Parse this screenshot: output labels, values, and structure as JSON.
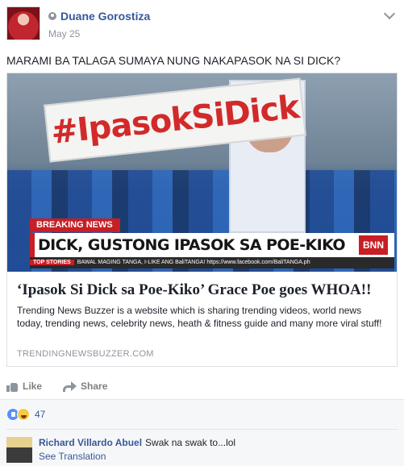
{
  "post": {
    "author": "Duane Gorostiza",
    "date": "May 25",
    "text": "MARAMI BA TALAGA SUMAYA NUNG NAKAPASOK NA SI DICK?"
  },
  "link_card": {
    "image": {
      "sign_text": "#IpasokSiDick",
      "breaking_label": "BREAKING NEWS",
      "headline": "DICK, GUSTONG IPASOK SA POE-KIKO",
      "logo": "BNN",
      "ticker_label": "TOP STORIES",
      "ticker_text": "BAWAL MAGING TANGA, I-LIKE ANG BaliTANGA! https://www.facebook.com/BaliTANGA.ph"
    },
    "title": "‘Ipasok Si Dick sa Poe-Kiko’ Grace Poe goes WHOA!!",
    "description": "Trending News Buzzer is a website which is sharing trending videos, world news today, trending news, celebrity news, heath & fitness guide and many more viral stuff!",
    "domain": "TRENDINGNEWSBUZZER.COM"
  },
  "actions": {
    "like_label": "Like",
    "share_label": "Share"
  },
  "reactions": {
    "count": "47"
  },
  "comment": {
    "author": "Richard Villardo Abuel",
    "text": "Swak na swak to...lol",
    "see_translation": "See Translation"
  },
  "colors": {
    "link_blue": "#365899",
    "muted_gray": "#90949c",
    "breaking_red": "#c81e25"
  }
}
